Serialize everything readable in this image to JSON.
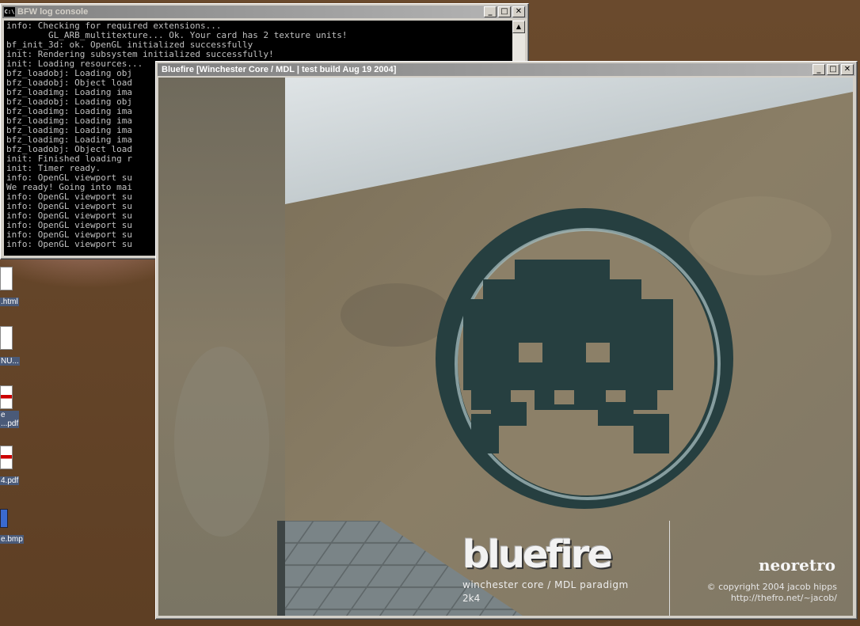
{
  "console": {
    "title": "BFW log console",
    "app_icon_text": "C:\\",
    "minimize": "_",
    "maximize": "□",
    "close": "✕",
    "lines": [
      "info: Checking for required extensions...",
      "        GL_ARB_multitexture... Ok. Your card has 2 texture units!",
      "bf_init_3d: ok. OpenGL initialized successfully",
      "init: Rendering subsystem initialized successfully!",
      "init: Loading resources...",
      "bfz_loadobj: Loading obj",
      "bfz_loadobj: Object load",
      "bfz_loadimg: Loading ima",
      "bfz_loadobj: Loading obj",
      "bfz_loadimg: Loading ima",
      "bfz_loadimg: Loading ima",
      "bfz_loadimg: Loading ima",
      "bfz_loadimg: Loading ima",
      "bfz_loadobj: Object load",
      "init: Finished loading r",
      "init: Timer ready.",
      "info: OpenGL viewport su",
      "We ready! Going into mai",
      "info: OpenGL viewport su",
      "info: OpenGL viewport su",
      "info: OpenGL viewport su",
      "info: OpenGL viewport su",
      "info: OpenGL viewport su",
      "info: OpenGL viewport su"
    ]
  },
  "bluefire": {
    "title": "Bluefire [Winchester Core / MDL | test build Aug 19 2004]",
    "minimize": "_",
    "maximize": "□",
    "close": "✕",
    "overlay": {
      "logo": "bluefire",
      "subtitle": "winchester core / MDL paradigm",
      "year": "2k4",
      "brand": "neoretro",
      "copyright": "© copyright 2004 jacob hipps",
      "url": "http://thefro.net/~jacob/"
    }
  },
  "desktop_icons": [
    {
      "label": ".html",
      "type": "doc"
    },
    {
      "label": "NU...",
      "type": "doc"
    },
    {
      "label": "e\n...pdf",
      "type": "pdf"
    },
    {
      "label": "4.pdf",
      "type": "pdf"
    },
    {
      "label": "e.bmp",
      "type": "bmp"
    }
  ],
  "colors": {
    "emblem": "#263f40",
    "wall": "#7d7464",
    "ceiling": "#c4ccd0",
    "console_bg": "#000000",
    "console_fg": "#c0c0c0"
  }
}
